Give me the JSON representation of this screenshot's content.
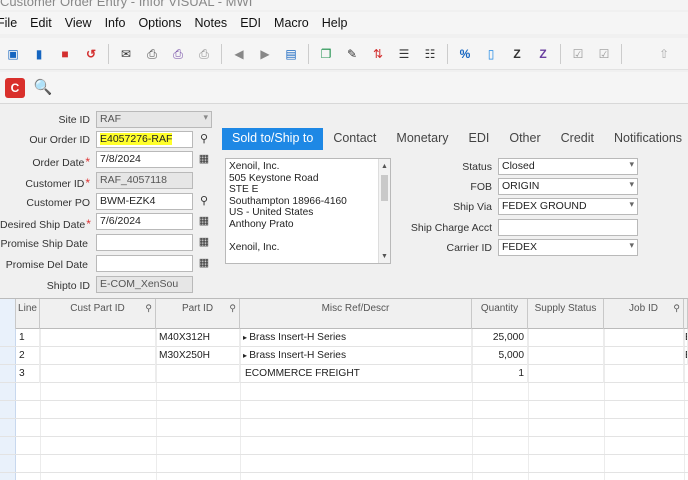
{
  "window": {
    "title": "Customer Order Entry - Infor VISUAL - MWI"
  },
  "menu": [
    "File",
    "Edit",
    "View",
    "Info",
    "Options",
    "Notes",
    "EDI",
    "Macro",
    "Help"
  ],
  "form": {
    "site_id": {
      "label": "Site ID",
      "value": "RAF"
    },
    "our_order_id": {
      "label": "Our Order ID",
      "value": "E4057276-RAF"
    },
    "order_date": {
      "label": "Order Date",
      "value": "7/8/2024"
    },
    "customer_id": {
      "label": "Customer ID",
      "value": "RAF_4057118"
    },
    "customer_po": {
      "label": "Customer PO",
      "value": "BWM-EZK4"
    },
    "desired_ship_date": {
      "label": "Desired Ship Date",
      "value": "7/6/2024"
    },
    "promise_ship_date": {
      "label": "Promise Ship Date",
      "value": ""
    },
    "promise_del_date": {
      "label": "Promise Del Date",
      "value": ""
    },
    "shipto_id": {
      "label": "Shipto ID",
      "value": "E-COM_XenSou"
    }
  },
  "tabs": [
    "Sold to/Ship to",
    "Contact",
    "Monetary",
    "EDI",
    "Other",
    "Credit",
    "Notifications"
  ],
  "address_lines": [
    "Xenoil, Inc.",
    "505 Keystone Road",
    "STE E",
    "Southampton 18966-4160",
    "US - United States",
    "Anthony Prato",
    "",
    "Xenoil, Inc."
  ],
  "right_fields": {
    "status": {
      "label": "Status",
      "value": "Closed"
    },
    "fob": {
      "label": "FOB",
      "value": "ORIGIN"
    },
    "ship_via": {
      "label": "Ship Via",
      "value": "FEDEX GROUND"
    },
    "ship_charge_acct": {
      "label": "Ship Charge Acct",
      "value": ""
    },
    "carrier_id": {
      "label": "Carrier ID",
      "value": "FEDEX"
    }
  },
  "grid": {
    "headers": [
      "Line",
      "Cust Part ID",
      "Part ID",
      "Misc Ref/Descr",
      "Quantity",
      "Supply Status",
      "Job ID"
    ],
    "rows": [
      {
        "line": "1",
        "cust_part": "",
        "part": "M40X312H",
        "descr": "Brass Insert-H Series",
        "qty": "25,000",
        "supply": "",
        "job": "",
        "extra": "B"
      },
      {
        "line": "2",
        "cust_part": "",
        "part": "M30X250H",
        "descr": "Brass Insert-H Series",
        "qty": "5,000",
        "supply": "",
        "job": "",
        "extra": "B"
      },
      {
        "line": "3",
        "cust_part": "",
        "part": "",
        "descr": "ECOMMERCE FREIGHT",
        "qty": "1",
        "supply": "",
        "job": "",
        "extra": ""
      }
    ]
  },
  "colors": {
    "tab_active": "#1e88e5",
    "highlight": "#ffff2a",
    "required": "#dd3333"
  }
}
